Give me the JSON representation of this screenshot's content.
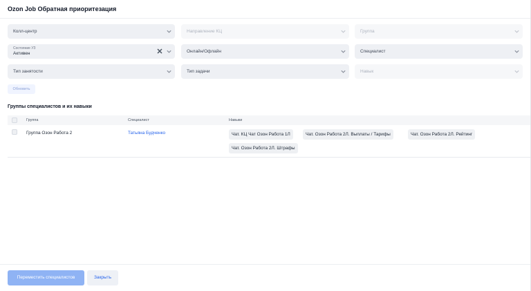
{
  "header": {
    "title": "Ozon Job Обратная приоритезация"
  },
  "filters": {
    "call_center": "Колл-центр",
    "direction": "Направление КЦ",
    "group": "Группа",
    "status_label": "Состояние УЗ",
    "status_value": "Активен",
    "online_offline": "Онлайн/Офлайн",
    "specialist": "Специалист",
    "employment_type": "Тип занятости",
    "task_type": "Тип задачи",
    "skills": "Навык"
  },
  "refresh_label": "Обновить",
  "section_title": "Группы специалистов и их навыки",
  "table": {
    "columns": [
      "Группа",
      "Специалист",
      "Навыки"
    ],
    "row": {
      "group": "Группа Озон Работа 2",
      "specialist": "Татьяна Будченко",
      "skills": [
        "Чат. КЦ Чат Озон Работа 1Л",
        "Чат. Озон Работа 2Л. Выплаты / Тарифы",
        "Чат. Озон Работа 2Л. Рейтинг",
        "Чат. Озон Работа 2Л. Штрафы"
      ]
    }
  },
  "footer": {
    "move_label": "Переместить специалистов",
    "close_label": "Закрыть"
  },
  "colors": {
    "accent": "#2563eb",
    "primary_button": "#8fb3f4",
    "field_bg": "#eef0f4"
  }
}
